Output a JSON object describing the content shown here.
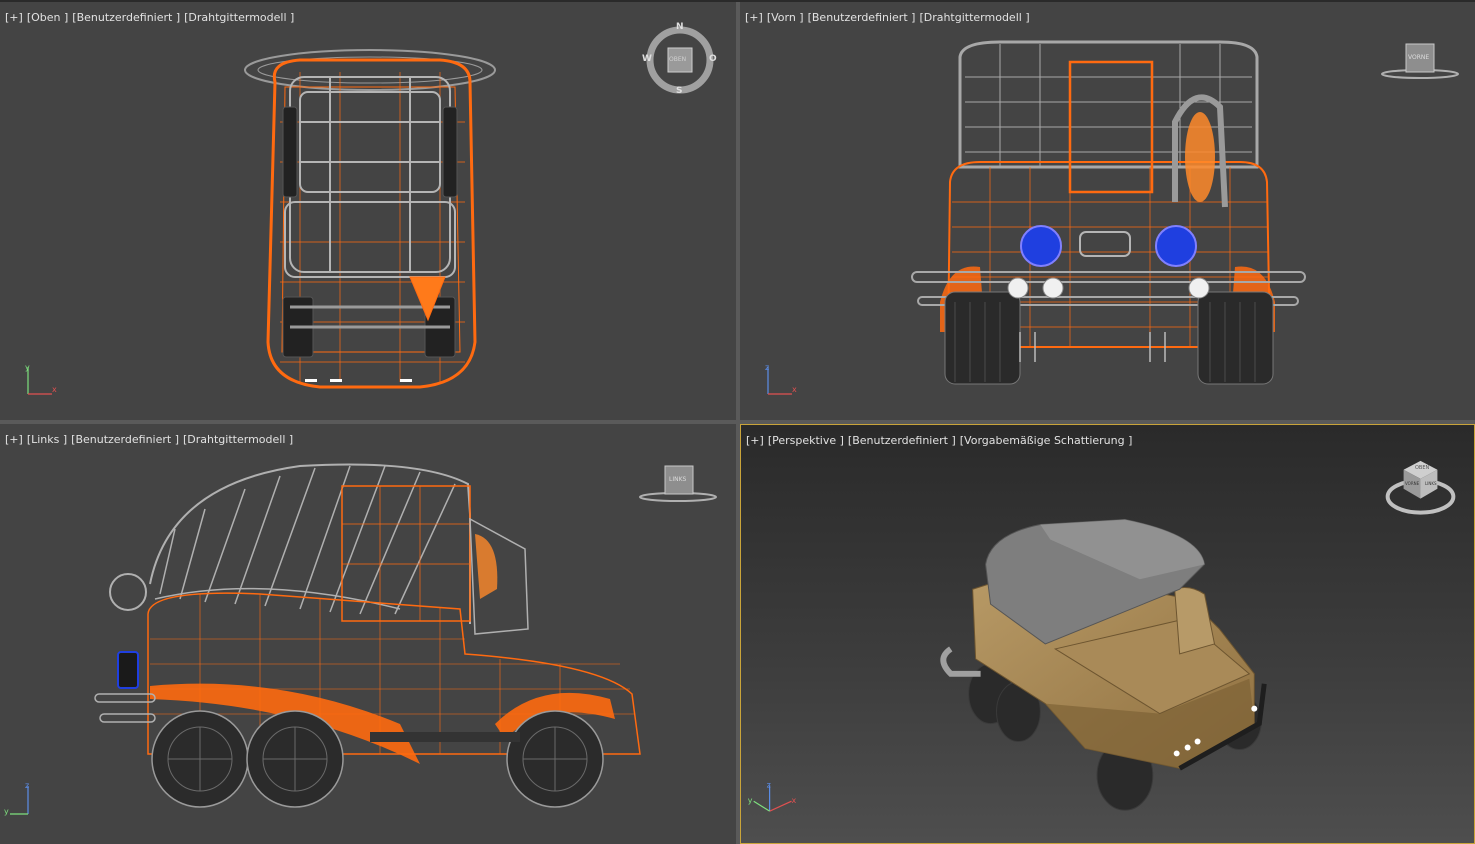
{
  "viewports": {
    "top": {
      "label_parts": [
        "[+]",
        "[Oben ]",
        "[Benutzerdefiniert ]",
        "[Drahtgittermodell ]"
      ],
      "compass": {
        "n": "N",
        "s": "S",
        "w": "W",
        "o": "O",
        "cube": "OBEN"
      }
    },
    "front": {
      "label_parts": [
        "[+]",
        "[Vorn ]",
        "[Benutzerdefiniert ]",
        "[Drahtgittermodell ]"
      ],
      "cube": "VORNE"
    },
    "left": {
      "label_parts": [
        "[+]",
        "[Links ]",
        "[Benutzerdefiniert ]",
        "[Drahtgittermodell ]"
      ],
      "cube": "LINKS"
    },
    "perspective": {
      "label_parts": [
        "[+]",
        "[Perspektive ]",
        "[Benutzerdefiniert ]",
        "[Vorgabemäßige Schattierung ]"
      ],
      "cube_top": "OBEN",
      "cube_front": "VORNE",
      "cube_side": "LINKS"
    }
  },
  "axes": {
    "x": "x",
    "y": "y",
    "z": "z"
  },
  "colors": {
    "wire_orange": "#ff6a10",
    "wire_gray": "#a9a9a9",
    "wire_dark": "#2b2b2b",
    "headlight_blue": "#1f3fe0",
    "active_border": "#c9a43a",
    "truck_body": "#a8885a",
    "truck_roof": "#8a8a8a"
  }
}
